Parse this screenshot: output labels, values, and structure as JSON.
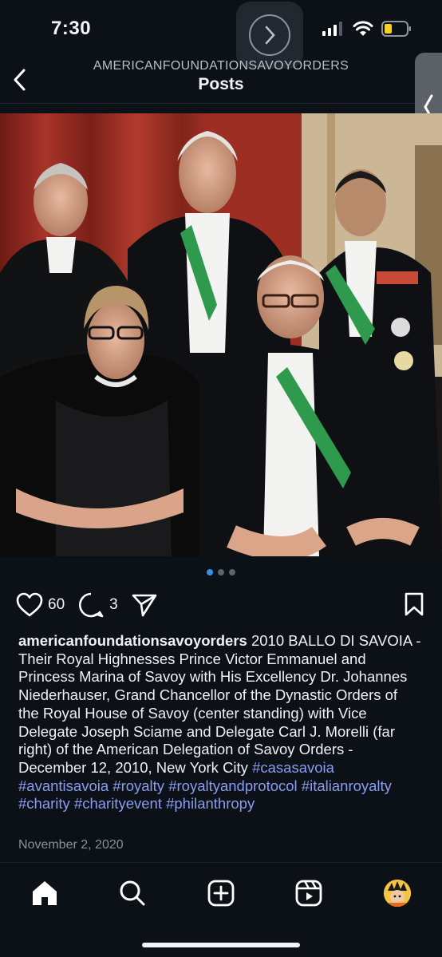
{
  "status": {
    "time": "7:30"
  },
  "header": {
    "account": "AMERICANFOUNDATIONSAVOYORDERS",
    "title": "Posts"
  },
  "post": {
    "likes": "60",
    "comments": "3",
    "carousel": {
      "total": 3,
      "active": 1
    },
    "caption": {
      "username": "americanfoundationsavoyorders",
      "text": " 2010 BALLO DI SAVOIA - Their Royal Highnesses Prince Victor Emmanuel and Princess Marina of Savoy with His Excellency Dr. Johannes Niederhauser, Grand Chancellor of the Dynastic Orders of the Royal House of Savoy (center standing) with Vice Delegate Joseph Sciame and Delegate Carl J. Morelli (far right) of the American Delegation of Savoy Orders - December 12, 2010, New York City ",
      "hashtags": [
        "#casasavoia",
        "#avantisavoia",
        "#royalty",
        "#royaltyandprotocol",
        "#italianroyalty",
        "#charity",
        "#charityevent",
        "#philanthropy"
      ]
    },
    "date": "November 2, 2020"
  },
  "icons": {
    "back": "chevron-left-icon",
    "like": "heart-icon",
    "comment": "speech-bubble-icon",
    "share": "paper-plane-icon",
    "save": "bookmark-icon",
    "nav": [
      "home-icon",
      "search-icon",
      "create-post-icon",
      "reels-icon",
      "profile-avatar"
    ]
  },
  "colors": {
    "background": "#0c1118",
    "hashtag": "#8a9cf0",
    "carousel_active": "#3a8ee8",
    "text": "#f2f4f7"
  }
}
